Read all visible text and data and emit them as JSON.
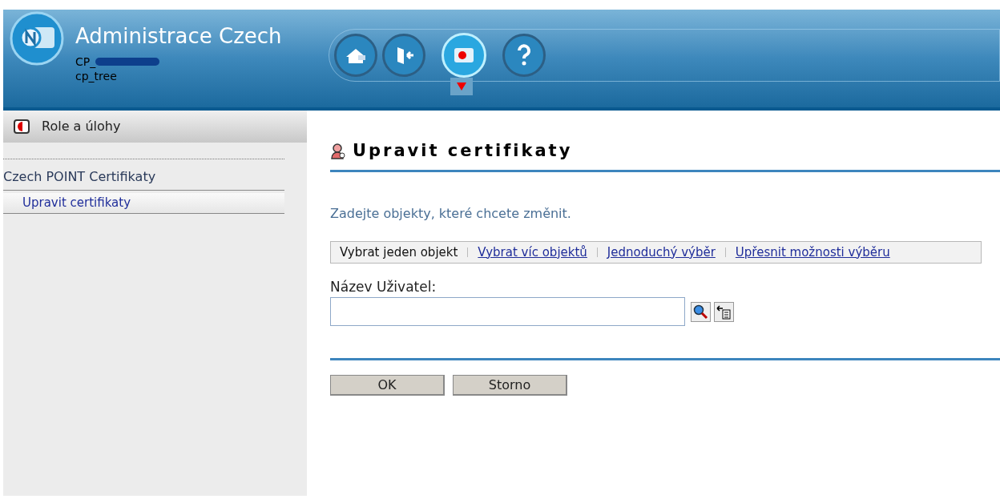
{
  "header": {
    "title": "Administrace Czech",
    "user_prefix": "CP_",
    "tree": "cp_tree",
    "toolbar": [
      {
        "kind": "home",
        "selected": false
      },
      {
        "kind": "exit",
        "selected": false
      },
      {
        "kind": "roles",
        "selected": true
      },
      {
        "kind": "help",
        "selected": false
      }
    ]
  },
  "sidebar": {
    "heading": "Role a úlohy",
    "category": "Czech POINT Certifikaty",
    "items": [
      {
        "label": "Upravit certifikaty",
        "selected": true
      }
    ]
  },
  "page": {
    "title": "Upravit certifikaty",
    "instruction": "Zadejte objekty, které chcete změnit.",
    "modes": [
      {
        "label": "Vybrat jeden objekt",
        "selected": true
      },
      {
        "label": "Vybrat víc objektů",
        "selected": false
      },
      {
        "label": "Jednoduchý výběr",
        "selected": false
      },
      {
        "label": "Upřesnit možnosti výběru",
        "selected": false
      }
    ],
    "field": {
      "label": "Název Uživatel:"
    },
    "buttons": [
      "OK",
      "Storno"
    ]
  }
}
